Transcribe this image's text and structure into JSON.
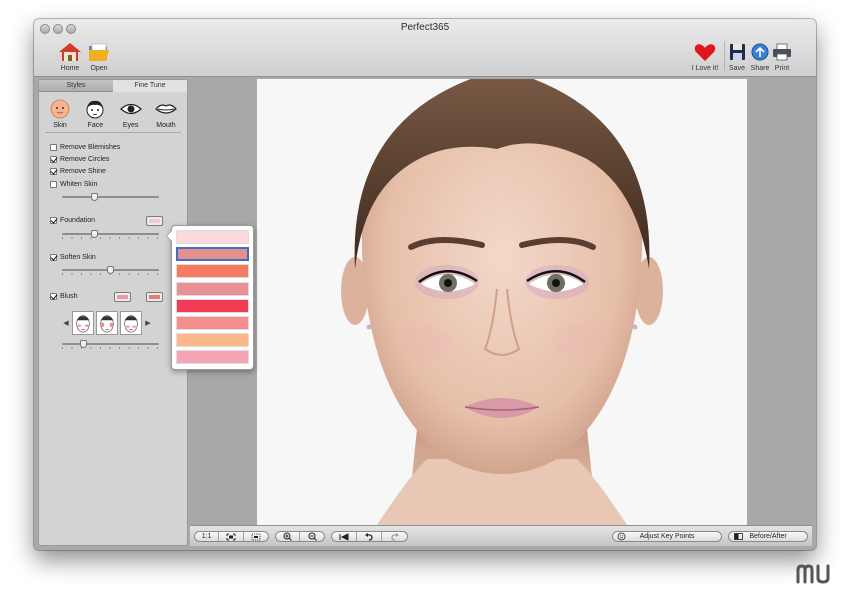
{
  "window": {
    "title": "Perfect365"
  },
  "toolbar": {
    "left": [
      {
        "label": "Home",
        "icon": "home-icon"
      },
      {
        "label": "Open",
        "icon": "open-folder-icon"
      }
    ],
    "right": [
      {
        "label": "I Love it!",
        "icon": "heart-icon"
      },
      {
        "label": "Save",
        "icon": "save-icon"
      },
      {
        "label": "Share",
        "icon": "share-icon"
      },
      {
        "label": "Print",
        "icon": "printer-icon"
      }
    ]
  },
  "sidebar": {
    "tabs": [
      {
        "label": "Styles",
        "active": false
      },
      {
        "label": "Fine Tune",
        "active": true
      }
    ],
    "parts": [
      {
        "label": "Skin",
        "icon": "skin-face-icon"
      },
      {
        "label": "Face",
        "icon": "face-icon"
      },
      {
        "label": "Eyes",
        "icon": "eye-icon"
      },
      {
        "label": "Mouth",
        "icon": "mouth-icon"
      }
    ],
    "options": [
      {
        "label": "Remove Blemishes",
        "checked": false
      },
      {
        "label": "Remove Circles",
        "checked": true
      },
      {
        "label": "Remove Shine",
        "checked": true
      },
      {
        "label": "Whiten Skin",
        "checked": false
      }
    ],
    "whiten_level": 0.32,
    "foundation": {
      "label": "Foundation",
      "checked": true,
      "swatch": "#f1c9d6",
      "level": 0.32
    },
    "soften": {
      "label": "Soften Skin",
      "checked": true,
      "level": 0.5
    },
    "blush": {
      "label": "Blush",
      "checked": true,
      "swatch_a": "#ec9aa8",
      "swatch_b": "#e57c6f",
      "level": 0.2
    }
  },
  "palette": {
    "colors": [
      "#fbd9dd",
      "#e78f8c",
      "#f57c63",
      "#e98f96",
      "#f23b55",
      "#f58d8c",
      "#fbb98b",
      "#f7a3b6"
    ],
    "selected_index": 1
  },
  "bottombar": {
    "zoom": [
      "1:1",
      "fit-icon",
      "actual-size-icon"
    ],
    "zoom_controls": [
      "zoom-in-icon",
      "zoom-out-icon"
    ],
    "history": [
      "first-icon",
      "undo-icon",
      "redo-icon"
    ],
    "adjust_label": "Adjust Key Points",
    "before_after_label": "Before/After"
  },
  "colors": {
    "accent": "#3d6fc4",
    "heart": "#e0161e"
  }
}
